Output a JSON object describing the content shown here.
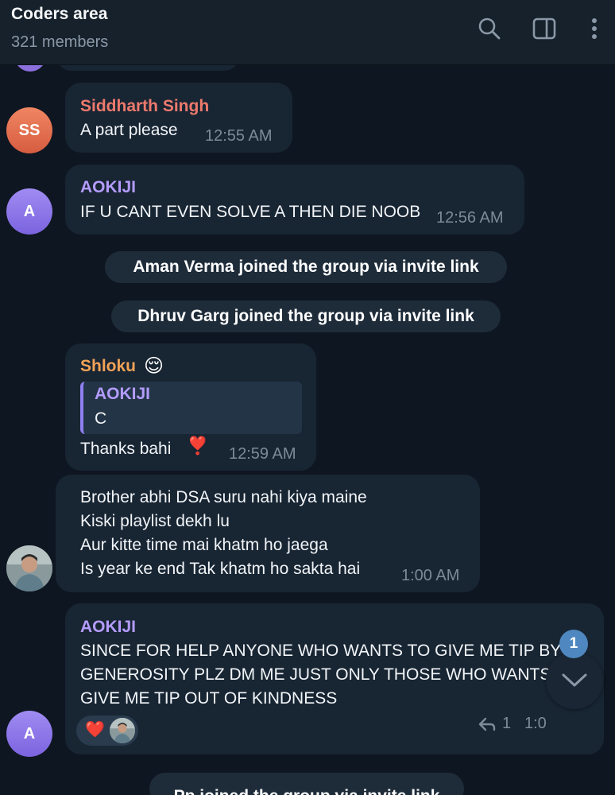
{
  "header": {
    "title": "Coders area",
    "subtitle": "321 members",
    "icons": [
      "search-icon",
      "sidebar-toggle-icon",
      "more-vertical-icon"
    ]
  },
  "messages": [
    {
      "sender": "Siddharth Singh",
      "sender_color": "#ee7a6d",
      "avatar": "SS",
      "text": "A part please",
      "time": "12:55 AM"
    },
    {
      "sender": "AOKIJI",
      "sender_color": "#b49cff",
      "avatar": "A",
      "text": "IF U CANT EVEN SOLVE A THEN DIE NOOB",
      "time": "12:56 AM"
    },
    {
      "sender": "Shloku",
      "sender_color": "#f2a358",
      "emoji": "😌",
      "reply_sender": "AOKIJI",
      "reply_text": "C",
      "text": "Thanks bahi",
      "text_emoji": "❣️",
      "time": "12:59 AM"
    },
    {
      "lines": [
        "Brother abhi DSA suru nahi kiya maine",
        "Kiski playlist dekh lu",
        "Aur kitte time mai khatm ho jaega",
        "Is year ke end Tak khatm ho sakta hai"
      ],
      "time": "1:00 AM",
      "avatar": "photo"
    },
    {
      "sender": "AOKIJI",
      "sender_color": "#b49cff",
      "avatar": "A",
      "lines": [
        "SINCE FOR HELP ANYONE WHO WANTS TO GIVE ME TIP BY",
        "GENEROSITY PLZ DM ME JUST ONLY THOSE WHO WANTS TO",
        "GIVE ME TIP OUT OF KINDNESS"
      ],
      "reaction": "❤️",
      "reply_count": "1",
      "time_partial": "1:0"
    }
  ],
  "service": [
    "Aman Verma joined the group via invite link",
    "Dhruv Garg joined the group via invite link",
    "Pp joined the group via invite link"
  ],
  "scroll": {
    "unread_badge": "1",
    "icon": "chevron-down-icon"
  },
  "colors": {
    "background": "#0e1621",
    "bubble": "#182533",
    "header": "#17212b"
  }
}
